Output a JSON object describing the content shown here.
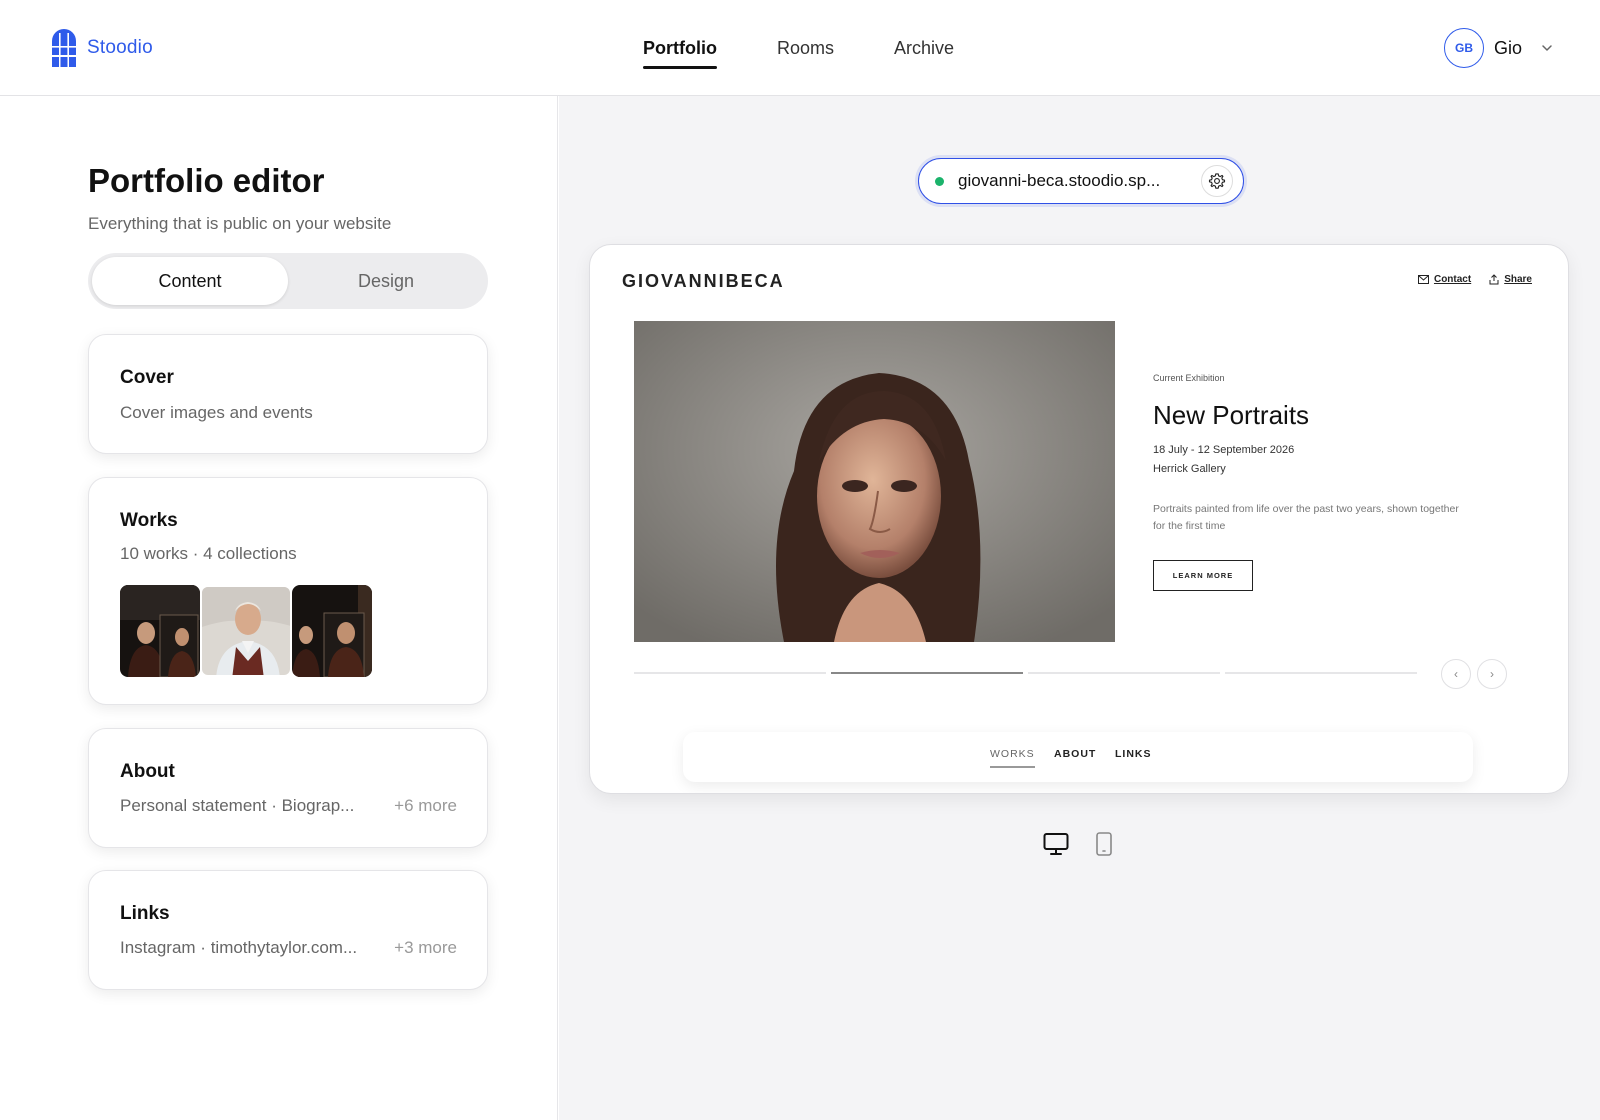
{
  "brand": {
    "name": "Stoodio",
    "accent": "#2f5bea"
  },
  "nav": {
    "items": [
      {
        "label": "Portfolio",
        "active": true
      },
      {
        "label": "Rooms",
        "active": false
      },
      {
        "label": "Archive",
        "active": false
      }
    ]
  },
  "user": {
    "initials": "GB",
    "name": "Gio"
  },
  "editor": {
    "title": "Portfolio editor",
    "subtitle": "Everything that is public on your website",
    "tabs": [
      {
        "label": "Content",
        "active": true
      },
      {
        "label": "Design",
        "active": false
      }
    ],
    "cards": {
      "cover": {
        "title": "Cover",
        "subtitle": "Cover images and events"
      },
      "works": {
        "title": "Works",
        "subtitle": "10 works · 4 collections"
      },
      "about": {
        "title": "About",
        "subtitle": "Personal statement · Biograp...",
        "more": "+6 more"
      },
      "links": {
        "title": "Links",
        "subtitle": "Instagram · timothytaylor.com...",
        "more": "+3 more"
      }
    }
  },
  "preview": {
    "url": "giovanni-beca.stoodio.sp...",
    "site_name": "GIOVANNIBECA",
    "header_links": {
      "contact": "Contact",
      "share": "Share"
    },
    "exhibition": {
      "label": "Current Exhibition",
      "title": "New Portraits",
      "dates": "18 July - 12 September 2026",
      "venue": "Herrick Gallery",
      "description": "Portraits painted from life over the past two years, shown together for the first time",
      "button": "LEARN MORE"
    },
    "slider": {
      "count": 4,
      "active_index": 1
    },
    "site_nav": [
      {
        "label": "WORKS",
        "active": true
      },
      {
        "label": "ABOUT",
        "active": false
      },
      {
        "label": "LINKS",
        "active": false
      }
    ],
    "device": {
      "selected": "desktop"
    }
  }
}
